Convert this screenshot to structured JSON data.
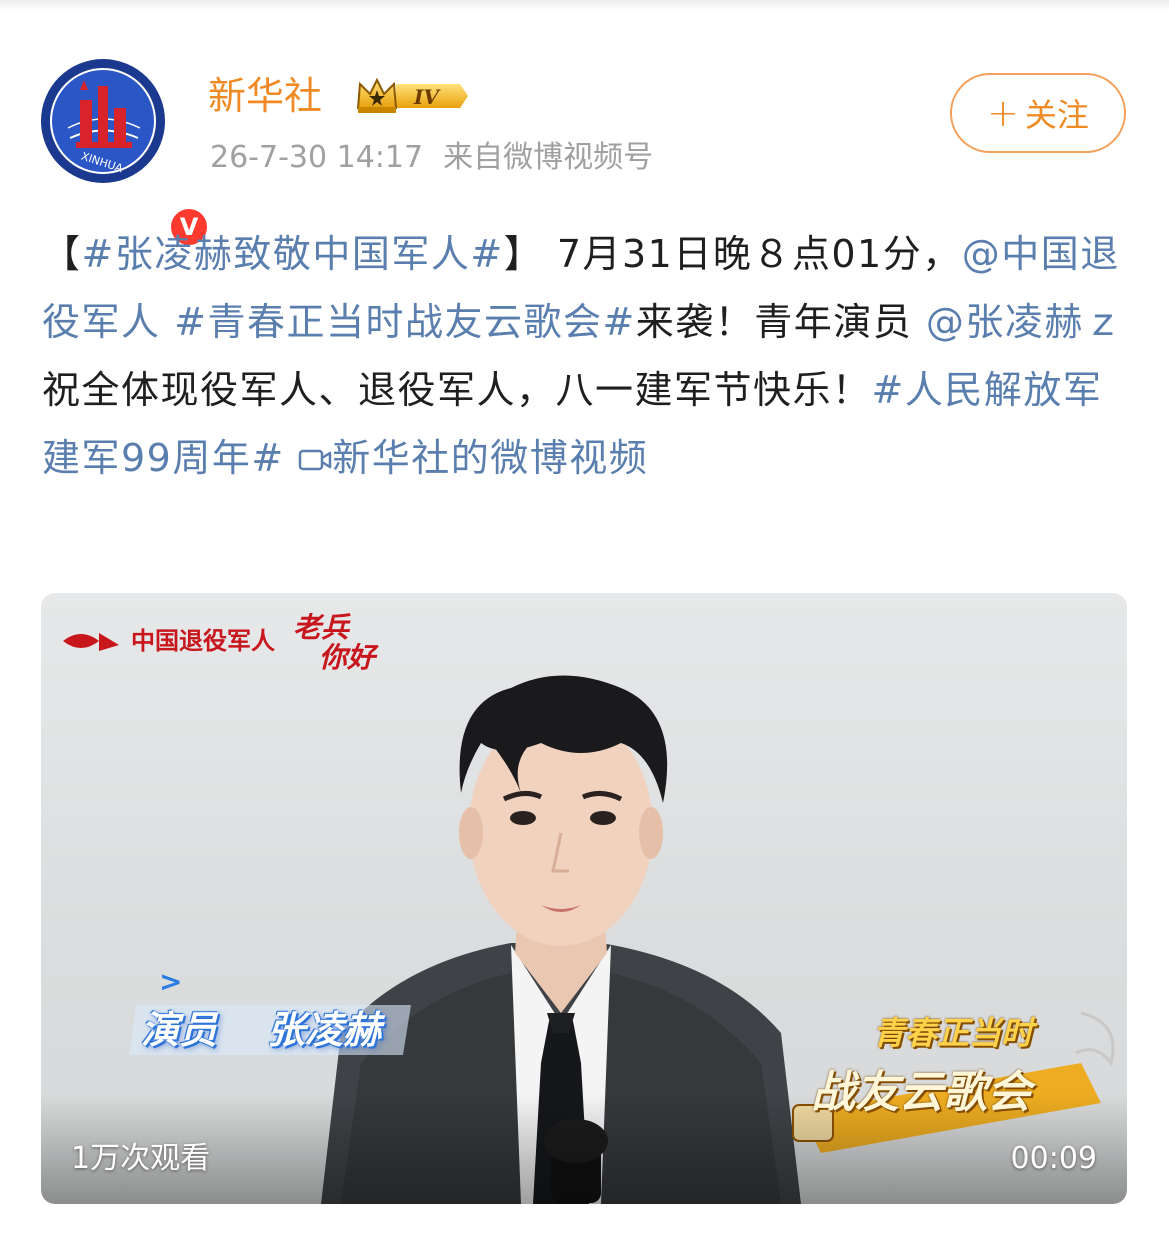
{
  "post": {
    "author": {
      "name": "新华社",
      "vip_level": "IV",
      "avatar_text": "XINHUA",
      "verified_mark": "V"
    },
    "time": "26-7-30 14:17",
    "source": "来自微博视频号",
    "follow_button": {
      "plus": "+",
      "label": "关注"
    },
    "text": {
      "bracket_open": "【",
      "hashtag_main": "#张凌赫致敬中国军人#",
      "bracket_close": "】",
      "segment_1": "7月31日晚８点01分，",
      "mention_1": "@中国退役军人",
      "hashtag_2": "#青春正当时战友云歌会#",
      "segment_2": "来袭！青年演员",
      "mention_2": "@张凌赫ｚ",
      "segment_3": "祝全体现役军人、退役军人，八一建军节快乐！",
      "hashtag_3": "#人民解放军建军99周年#",
      "video_link": "新华社的微博视频"
    },
    "video": {
      "brand_name": "中国退役军人",
      "brand_slogan_line1": "老兵",
      "brand_slogan_line2": "你好",
      "caption_arrow": ">",
      "caption_role": "演员",
      "caption_name": "张凌赫",
      "show_title_line1": "青春正当时",
      "show_title_line2": "战友云歌会",
      "views": "1万次观看",
      "duration": "00:09"
    }
  },
  "colors": {
    "username": "#f08a24",
    "link": "#5a7fae",
    "meta": "#a0a0a0",
    "follow_border": "#f5a05a",
    "brand_red": "#c8161d"
  },
  "icons": {
    "vip": "crown-icon",
    "verified": "verified-badge-icon",
    "video_link": "video-camera-icon",
    "plus": "plus-icon"
  }
}
